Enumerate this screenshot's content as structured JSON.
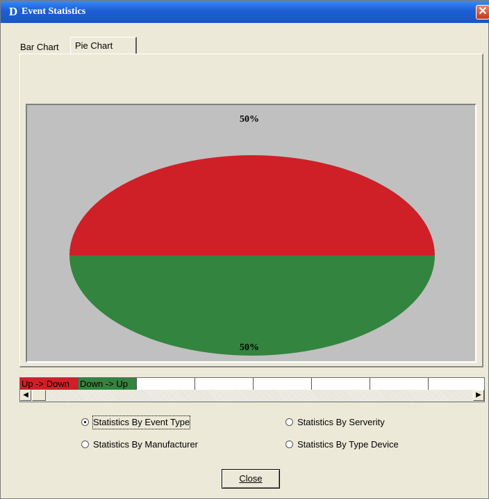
{
  "window": {
    "logo": "D",
    "title": "Event Statistics",
    "close_glyph": "✕"
  },
  "tabs": [
    {
      "label": "Bar Chart",
      "active": false
    },
    {
      "label": "Pie Chart",
      "active": true
    }
  ],
  "chart_data": {
    "type": "pie",
    "categories": [
      "Up -> Down",
      "Down -> Up"
    ],
    "values": [
      50,
      50
    ],
    "data_labels": [
      "50%",
      "50%"
    ],
    "colors": [
      "#cf2027",
      "#32843f"
    ],
    "background": "#c0c0c0"
  },
  "legend": {
    "items": [
      {
        "label": "Up -> Down",
        "color": "#cf2027"
      },
      {
        "label": "Down -> Up",
        "color": "#32843f"
      }
    ],
    "scroll_left_icon": "◀",
    "scroll_right_icon": "▶"
  },
  "options": {
    "by_event_type": {
      "label": "Statistics By Event Type",
      "selected": true
    },
    "by_serverity": {
      "label": "Statistics By Serverity",
      "selected": false
    },
    "by_manufacturer": {
      "label": "Statistics By Manufacturer",
      "selected": false
    },
    "by_type_device": {
      "label": "Statistics By Type Device",
      "selected": false
    }
  },
  "buttons": {
    "close": "Close"
  }
}
